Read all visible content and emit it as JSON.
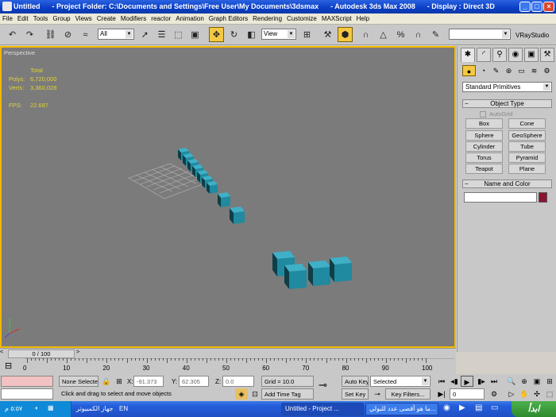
{
  "window": {
    "title": "Untitled      - Project Folder: C:\\Documents and Settings\\Free User\\My Documents\\3dsmax      - Autodesk 3ds Max 2008      - Display : Direct 3D"
  },
  "menu": [
    "File",
    "Edit",
    "Tools",
    "Group",
    "Views",
    "Create",
    "Modifiers",
    "reactor",
    "Animation",
    "Graph Editors",
    "Rendering",
    "Customize",
    "MAXScript",
    "Help"
  ],
  "toolbar": {
    "selection_filter": "All",
    "ref_coord": "View",
    "named_selection": "",
    "vray_label": "VRayStudio"
  },
  "viewport": {
    "label": "Perspective",
    "stats": {
      "total_label": "Total",
      "polys_label": "Polys:",
      "polys_value": "6,720,000",
      "verts_label": "Verts:",
      "verts_value": "3,360,028",
      "fps_label": "FPS:",
      "fps_value": "22.687"
    }
  },
  "cmdpanel": {
    "category": "Standard Primitives",
    "object_type_header": "Object Type",
    "autogrid": "AutoGrid",
    "buttons": [
      "Box",
      "Cone",
      "Sphere",
      "GeoSphere",
      "Cylinder",
      "Tube",
      "Torus",
      "Pyramid",
      "Teapot",
      "Plane"
    ],
    "name_color_header": "Name and Color",
    "name_value": "",
    "color": "#8a1530"
  },
  "timeline": {
    "frame_readout": "0 / 100",
    "ticks": [
      "0",
      "10",
      "20",
      "30",
      "40",
      "50",
      "60",
      "70",
      "80",
      "90",
      "100"
    ]
  },
  "status": {
    "selection": "None Selecte",
    "x_label": "X:",
    "x_value": "-91.373",
    "y_label": "Y:",
    "y_value": "62.305",
    "z_label": "Z:",
    "z_value": "0.0",
    "grid": "Grid = 10.0",
    "autokey": "Auto Key",
    "key_mode": "Selected",
    "setkey": "Set Key",
    "keyfilters": "Key Filters...",
    "frame": "0",
    "prompt": "Click and drag to select and move objects",
    "addtimetag": "Add Time Tag"
  },
  "taskbar": {
    "clock": "٥:٥٧ م",
    "lang": "EN",
    "tasks": [
      "Untitled     - Project ...",
      "ما هو أقصى عدد للبولي..."
    ],
    "computer": "جهاز الكمبيوتر",
    "start_label": "ابدأ"
  },
  "colors": {
    "viewport_bg": "#7b7b7b",
    "active_border": "#f2b800",
    "box_color": "#1f8aa0",
    "stats_color": "#e2d430"
  }
}
